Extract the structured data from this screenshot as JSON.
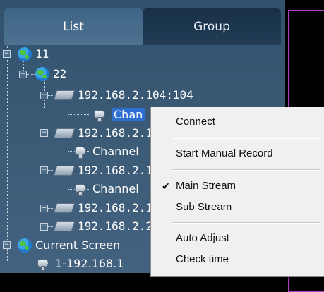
{
  "tabs": {
    "list": "List",
    "group": "Group"
  },
  "tree": {
    "root": "11",
    "child": "22",
    "device_full": "192.168.2.104:104",
    "selected_channel": "Chan",
    "device_2": "192.168.2.1",
    "channel_2": "Channel",
    "device_3": "192.168.2.1",
    "channel_3": "Channel",
    "device_4": "192.168.2.1",
    "device_5": "192.168.2.2",
    "current_screen": "Current Screen",
    "current_item": "1-192.168.1"
  },
  "context_menu": {
    "connect": "Connect",
    "start_manual_record": "Start Manual Record",
    "main_stream": "Main Stream",
    "main_stream_checked": "✔",
    "sub_stream": "Sub Stream",
    "auto_adjust": "Auto Adjust",
    "check_time": "Check time"
  },
  "colors": {
    "accent": "#b13ac9",
    "selection": "#2f6fd2"
  }
}
